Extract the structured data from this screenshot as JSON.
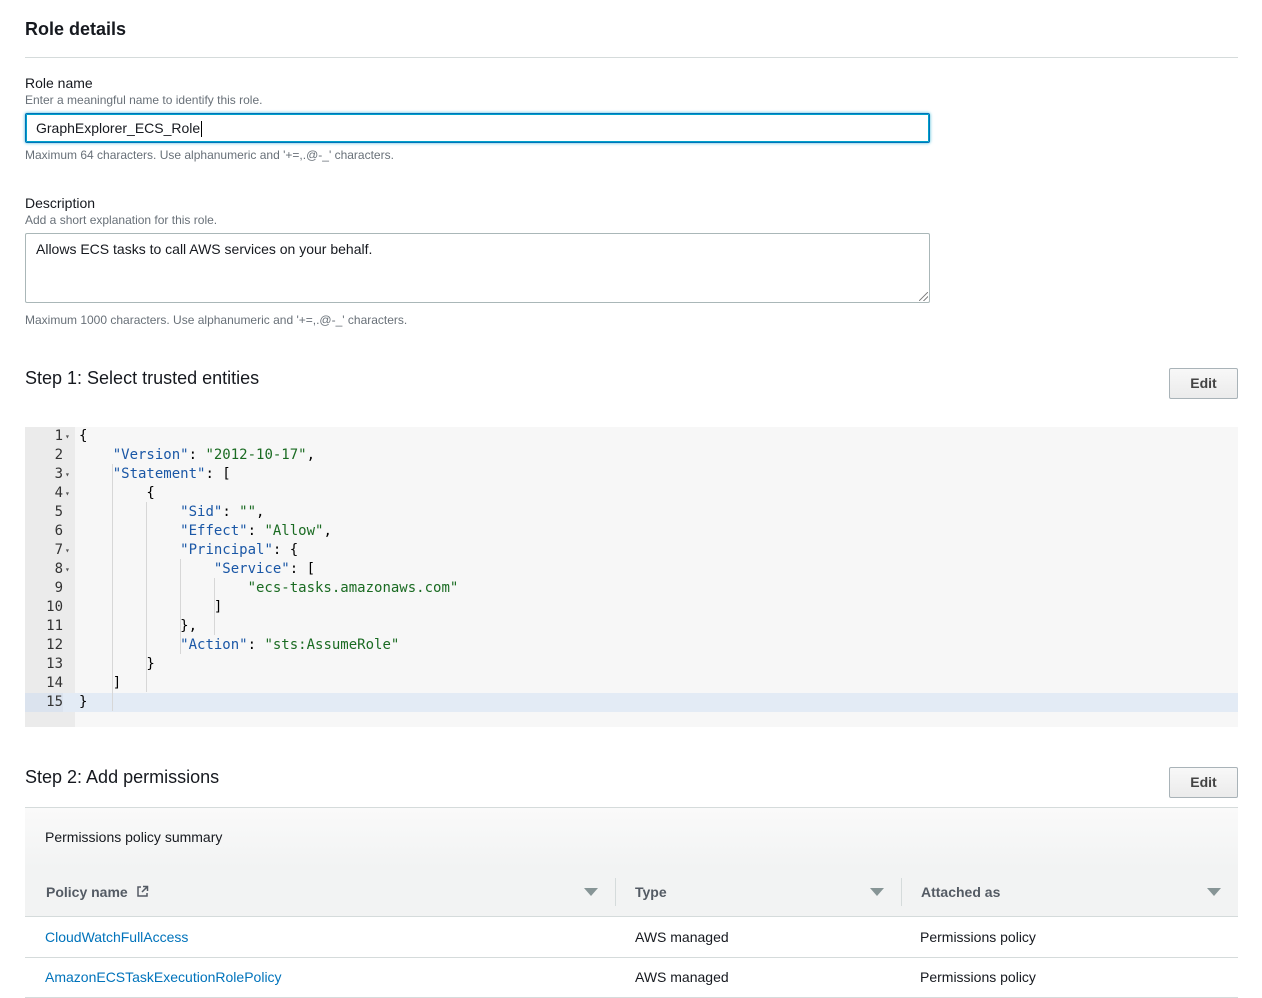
{
  "role_details": {
    "title": "Role details",
    "role_name": {
      "label": "Role name",
      "description": "Enter a meaningful name to identify this role.",
      "value": "GraphExplorer_ECS_Role",
      "constraint": "Maximum 64 characters. Use alphanumeric and '+=,.@-_' characters."
    },
    "description": {
      "label": "Description",
      "description": "Add a short explanation for this role.",
      "value": "Allows ECS tasks to call AWS services on your behalf.",
      "constraint": "Maximum 1000 characters. Use alphanumeric and '+=,.@-_' characters."
    }
  },
  "step1": {
    "title": "Step 1: Select trusted entities",
    "edit_label": "Edit",
    "code_lines": [
      {
        "n": "1",
        "fold": true
      },
      {
        "n": "2",
        "fold": false
      },
      {
        "n": "3",
        "fold": true
      },
      {
        "n": "4",
        "fold": true
      },
      {
        "n": "5",
        "fold": false
      },
      {
        "n": "6",
        "fold": false
      },
      {
        "n": "7",
        "fold": true
      },
      {
        "n": "8",
        "fold": true
      },
      {
        "n": "9",
        "fold": false
      },
      {
        "n": "10",
        "fold": false
      },
      {
        "n": "11",
        "fold": false
      },
      {
        "n": "12",
        "fold": false
      },
      {
        "n": "13",
        "fold": false
      },
      {
        "n": "14",
        "fold": false
      },
      {
        "n": "15",
        "fold": false
      }
    ],
    "tokens": {
      "version_key": "\"Version\"",
      "version_val": "\"2012-10-17\"",
      "statement_key": "\"Statement\"",
      "sid_key": "\"Sid\"",
      "sid_val": "\"\"",
      "effect_key": "\"Effect\"",
      "effect_val": "\"Allow\"",
      "principal_key": "\"Principal\"",
      "service_key": "\"Service\"",
      "service_val": "\"ecs-tasks.amazonaws.com\"",
      "action_key": "\"Action\"",
      "action_val": "\"sts:AssumeRole\""
    }
  },
  "step2": {
    "title": "Step 2: Add permissions",
    "edit_label": "Edit",
    "summary_title": "Permissions policy summary",
    "columns": [
      "Policy name",
      "Type",
      "Attached as"
    ],
    "rows": [
      {
        "name": "CloudWatchFullAccess",
        "type": "AWS managed",
        "attached": "Permissions policy"
      },
      {
        "name": "AmazonECSTaskExecutionRolePolicy",
        "type": "AWS managed",
        "attached": "Permissions policy"
      }
    ]
  }
}
